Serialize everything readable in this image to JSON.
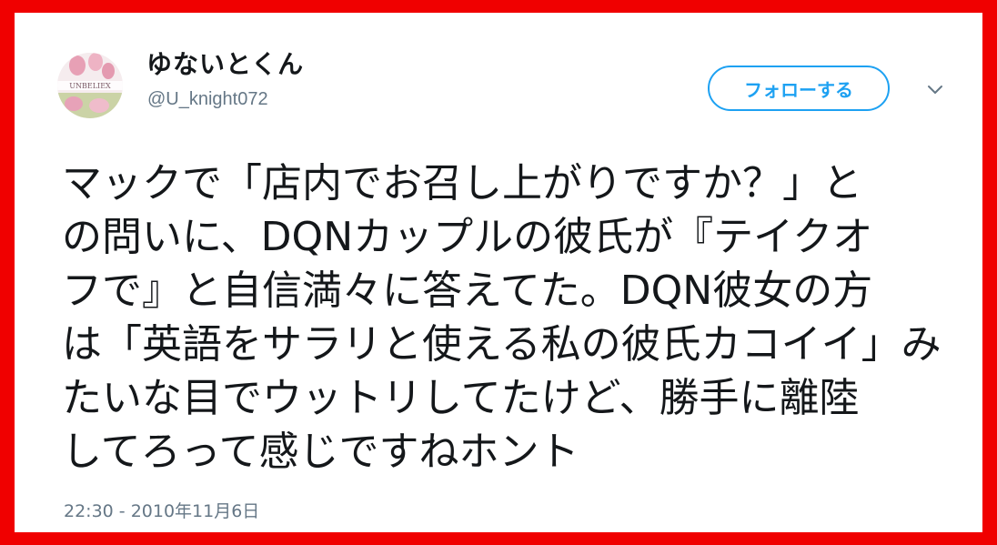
{
  "tweet": {
    "author": {
      "display_name": "ゆないとくん",
      "handle": "@U_knight072",
      "avatar_text": "UNBELIEX"
    },
    "follow_button_label": "フォローする",
    "menu_icon": "chevron-down-icon",
    "text_lines": [
      "マックで「店内でお召し上がりですか？」と",
      "の問いに、DQNカップルの彼氏が『テイクオ",
      "フで』と自信満々に答えてた。DQN彼女の方",
      "は「英語をサラリと使える私の彼氏カコイイ」み",
      "たいな目でウットリしてたけど、勝手に離陸",
      "してろって感じですねホント"
    ],
    "timestamp": "22:30 - 2010年11月6日"
  },
  "colors": {
    "frame_border": "#f00000",
    "accent": "#1da1f2",
    "text_primary": "#14171a",
    "text_secondary": "#657786"
  }
}
